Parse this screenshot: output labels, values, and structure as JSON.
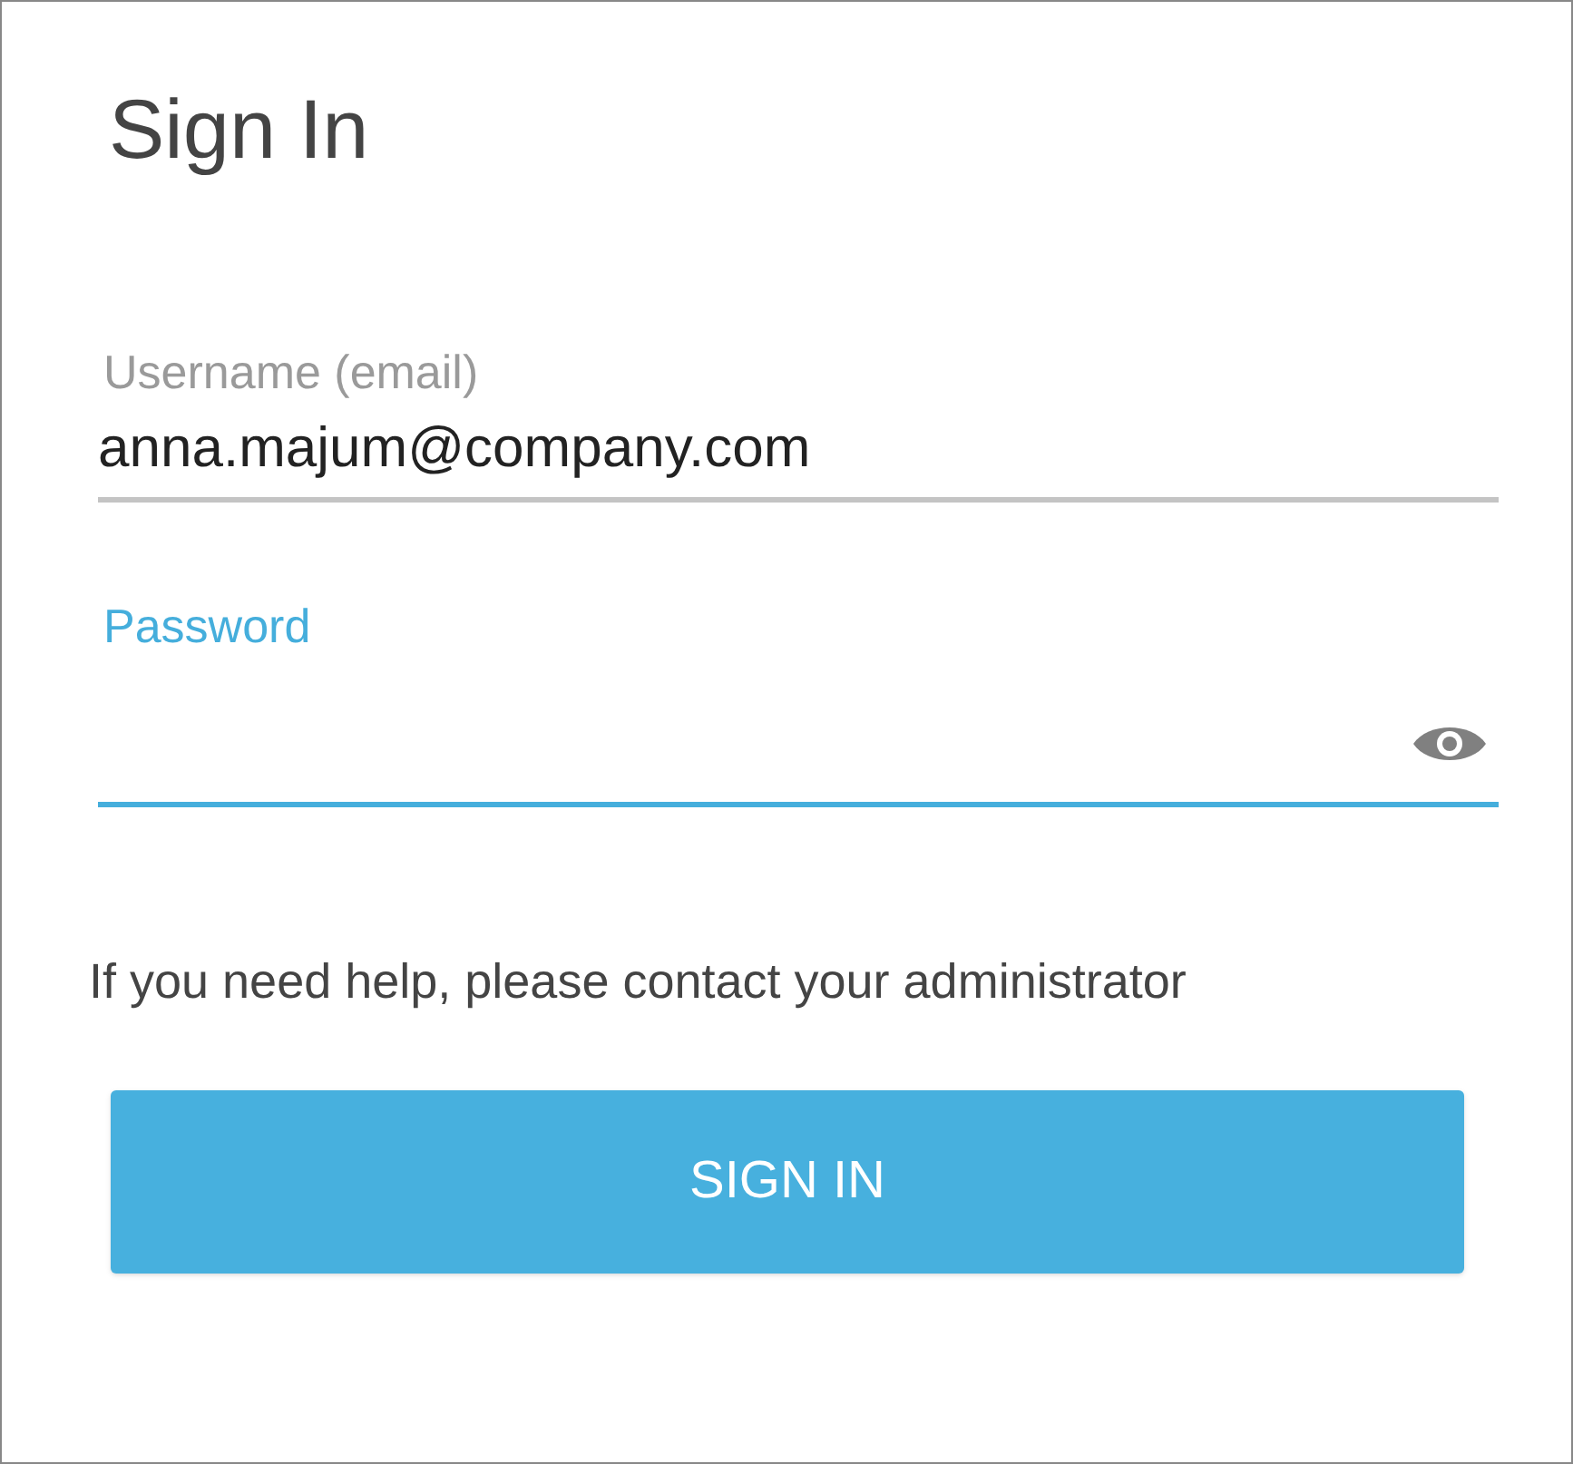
{
  "title": "Sign In",
  "fields": [
    {
      "label": "Username (email)",
      "value": "anna.majum@company.com",
      "focused": false,
      "kind": "text"
    },
    {
      "label": "Password",
      "focused": true,
      "kind": "password"
    }
  ],
  "help_text": "If you need help, please contact your administrator",
  "button": "SIGN IN"
}
